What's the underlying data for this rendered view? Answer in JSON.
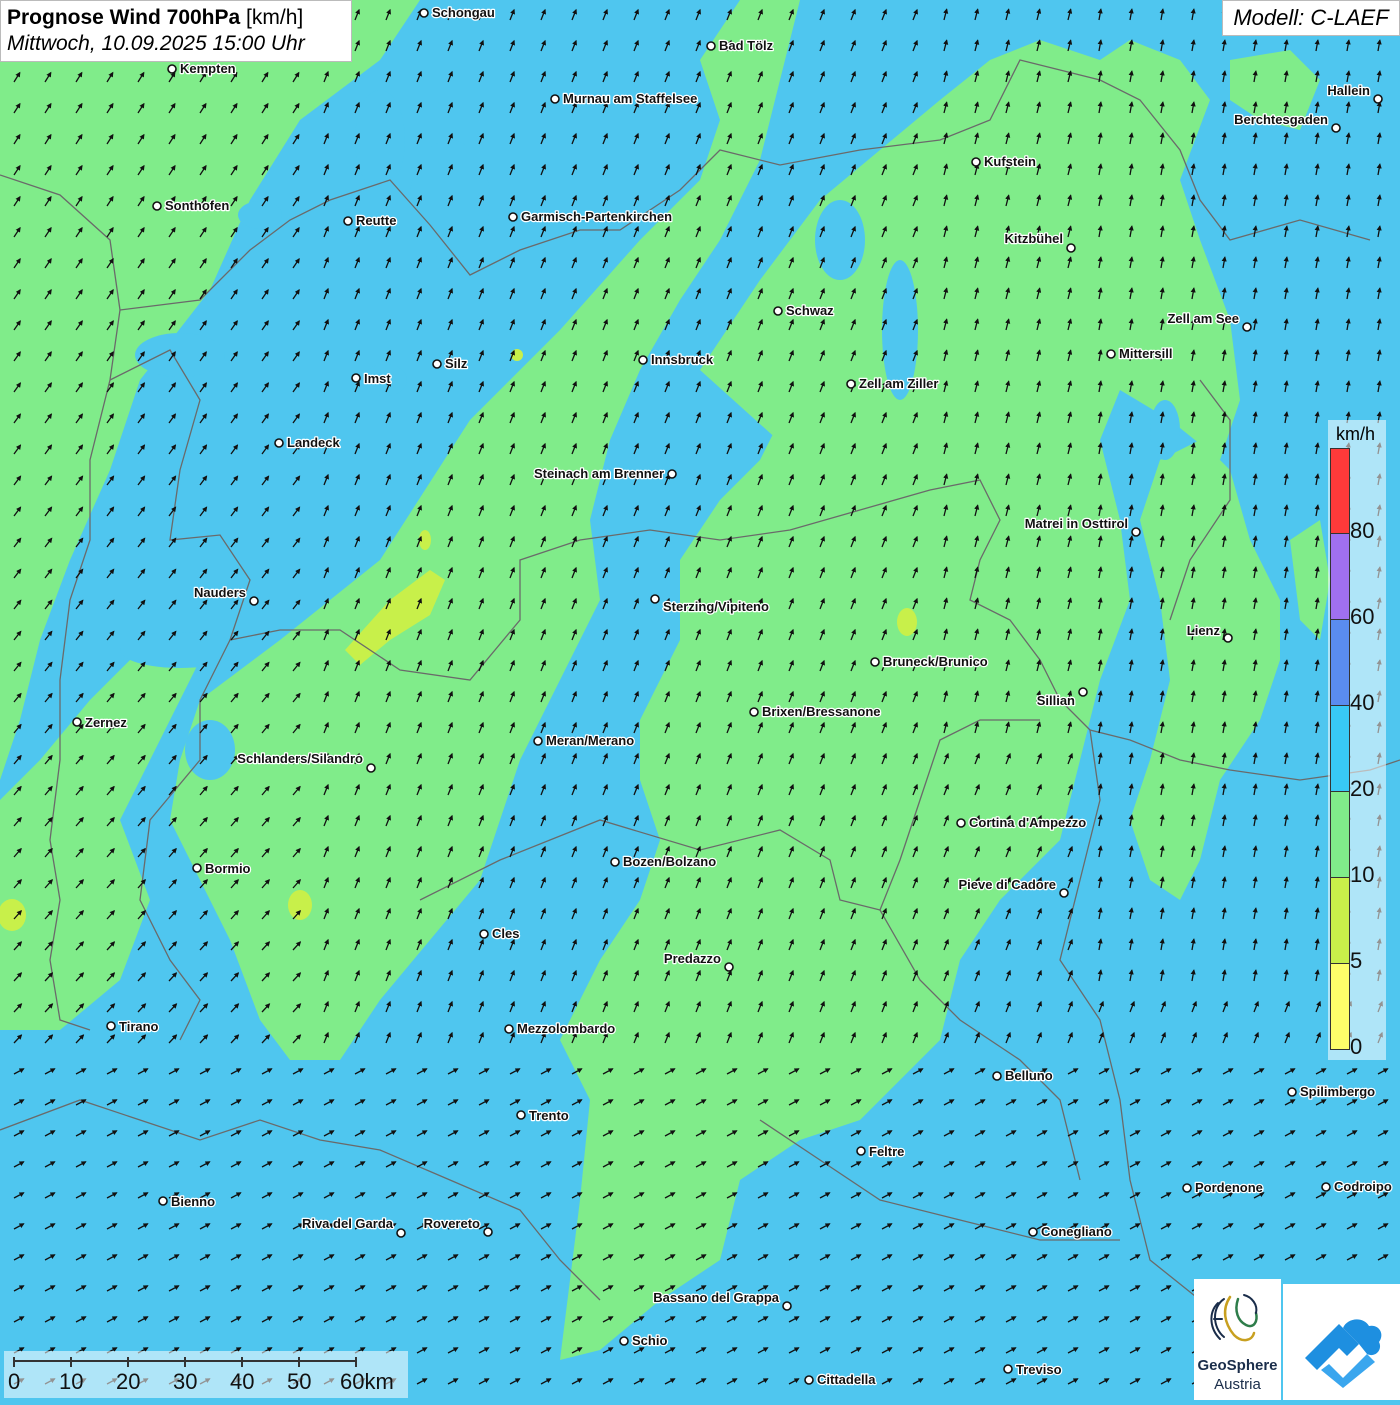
{
  "header": {
    "title_bold": "Prognose Wind 700hPa",
    "title_unit": "[km/h]",
    "subtitle": "Mittwoch, 10.09.2025 15:00 Uhr"
  },
  "model_label": "Modell: C-LAEF",
  "legend": {
    "unit": "km/h",
    "ticks": [
      "80",
      "60",
      "40",
      "20",
      "10",
      "5",
      "0"
    ],
    "colors": [
      "#ff3a3a",
      "#a070f0",
      "#5a8cf0",
      "#38c8f5",
      "#80ec8a",
      "#c8f04a",
      "#ffff6a"
    ]
  },
  "scalebar": {
    "ticks": [
      "0",
      "10",
      "20",
      "30",
      "40",
      "50",
      "60km"
    ]
  },
  "logos": {
    "geosphere_line1": "GeoSphere",
    "geosphere_line2": "Austria",
    "app_icon": "cloud-arrow-icon"
  },
  "map_colors": {
    "speed_10_20": "#80ec8a",
    "speed_20_40": "#4fc6ef",
    "speed_5_10": "#c8f04a",
    "border": "#6a6a6a"
  },
  "cities": [
    "Schongau",
    "Kempten",
    "Bad Tölz",
    "Murnau am Staffelsee",
    "Hallein",
    "Berchtesgaden",
    "Kufstein",
    "Sonthofen",
    "Reutte",
    "Garmisch-Partenkirchen",
    "Kitzbühel",
    "Schwaz",
    "Zell am See",
    "Mittersill",
    "Innsbruck",
    "Imst",
    "Silz",
    "Zell am Ziller",
    "Landeck",
    "Steinach am Brenner",
    "Matrei in Osttirol",
    "Nauders",
    "Sterzing/Vipiteno",
    "Lienz",
    "Bruneck/Brunico",
    "Sillian",
    "Zernez",
    "Brixen/Bressanone",
    "Meran/Merano",
    "Schlanders/Silandro",
    "Cortina d'Ampezzo",
    "Bormio",
    "Bozen/Bolzano",
    "Pieve di Cadore",
    "Cles",
    "Predazzo",
    "Tirano",
    "Mezzolombardo",
    "Belluno",
    "Spilimbergo",
    "Trento",
    "Feltre",
    "Bienno",
    "Pordenone",
    "Codroipo",
    "Riva del Garda",
    "Rovereto",
    "Conegliano",
    "Bassano del Grappa",
    "Schio",
    "Treviso",
    "Cittadella"
  ]
}
